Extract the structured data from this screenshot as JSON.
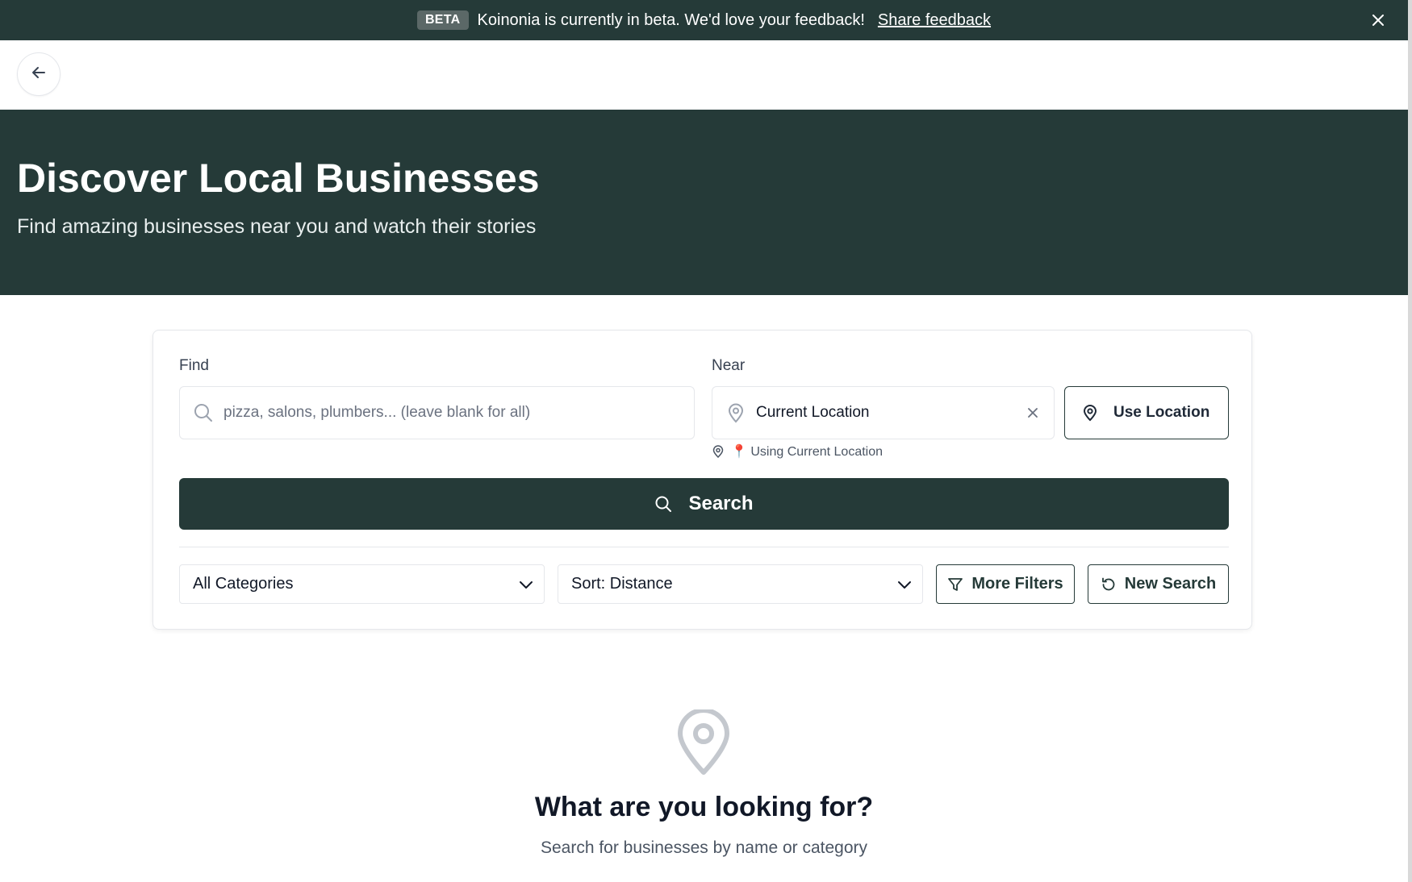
{
  "banner": {
    "badge": "BETA",
    "message": "Koinonia is currently in beta. We'd love your feedback!",
    "link": "Share feedback",
    "close_icon": "close-icon"
  },
  "nav": {
    "back_icon": "arrow-left-icon"
  },
  "hero": {
    "title": "Discover Local Businesses",
    "subtitle": "Find amazing businesses near you and watch their stories"
  },
  "search": {
    "find_label": "Find",
    "find_placeholder": "pizza, salons, plumbers... (leave blank for all)",
    "near_label": "Near",
    "near_value": "Current Location",
    "use_location_label": "Use Location",
    "location_hint": "📍 Using Current Location",
    "search_label": "Search"
  },
  "filters": {
    "category": "All Categories",
    "sort": "Sort: Distance",
    "more_filters": "More Filters",
    "new_search": "New Search"
  },
  "empty_state": {
    "title": "What are you looking for?",
    "subtitle": "Search for businesses by name or category"
  },
  "colors": {
    "brand_dark": "#253a38",
    "badge": "#5b6867",
    "border": "#e5e7eb"
  }
}
